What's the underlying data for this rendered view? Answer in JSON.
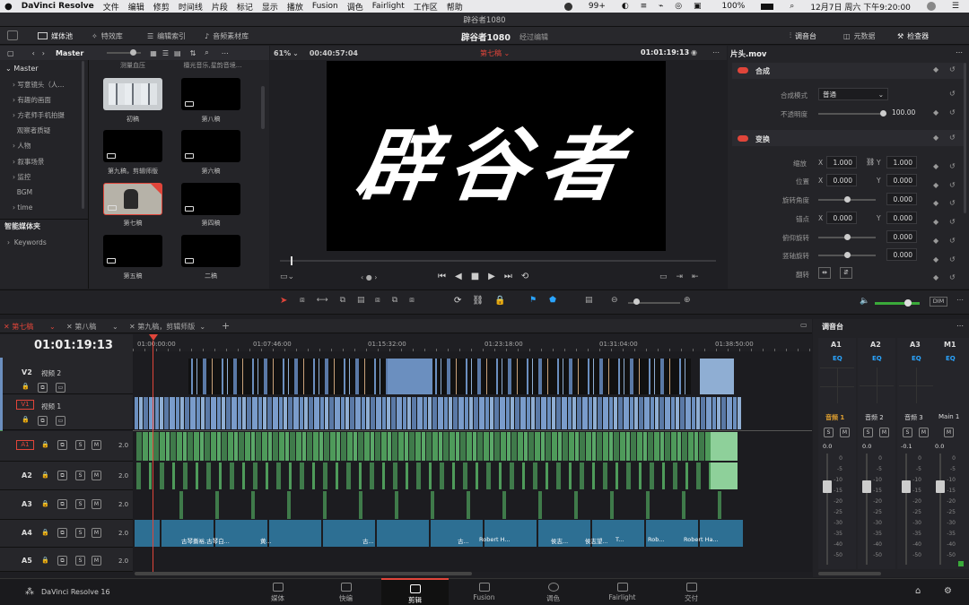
{
  "menubar": {
    "apple": "",
    "app": "DaVinci Resolve",
    "items": [
      "文件",
      "编辑",
      "修剪",
      "时间线",
      "片段",
      "标记",
      "显示",
      "播放",
      "Fusion",
      "调色",
      "Fairlight",
      "工作区",
      "帮助"
    ],
    "window_title": "辟谷者1080",
    "wechat_badge": "99+",
    "battery": "100%",
    "datetime": "12月7日 周六 下午9:20:00"
  },
  "toolbar": {
    "media_pool": "媒体池",
    "effects": "特效库",
    "edit_index": "编辑索引",
    "sound_library": "音频素材库",
    "project_title": "辟谷者1080",
    "project_status": "经过编辑",
    "mixer": "调音台",
    "metadata": "元数据",
    "inspector": "检查器"
  },
  "media_pool": {
    "bin_name": "Master",
    "tree_root": "Master",
    "bins": [
      "写意镜头（人...",
      "有趣的画面",
      "方老师手机拍摄",
      "观察者质疑",
      "人物",
      "叙事场景",
      "监控",
      "BGM",
      "time"
    ],
    "smart_bins_title": "智能媒体夹",
    "smart_bins": [
      "Keywords"
    ],
    "top_labels": [
      "测量血压",
      "檀光音乐,星韵音境..."
    ],
    "clips": [
      "初稿",
      "第八稿",
      "第九稿，剪辑师版",
      "第六稿",
      "第七稿",
      "第四稿",
      "第五稿",
      "二稿"
    ]
  },
  "viewer": {
    "zoom": "61%",
    "duration": "00:40:57:04",
    "timeline_name": "第七稿",
    "timecode": "01:01:19:13",
    "title_art": "辟谷者"
  },
  "inspector": {
    "clip_name": "片头.mov",
    "composite_section": "合成",
    "blend_mode_label": "合成模式",
    "blend_mode_value": "普通",
    "opacity_label": "不透明度",
    "opacity_value": "100.00",
    "transform_section": "变换",
    "zoom_label": "缩放",
    "zoom_x": "1.000",
    "zoom_y": "1.000",
    "position_label": "位置",
    "pos_x": "0.000",
    "pos_y": "0.000",
    "rotation_label": "旋转角度",
    "rotation_value": "0.000",
    "anchor_label": "锚点",
    "anchor_x": "0.000",
    "anchor_y": "0.000",
    "pitch_label": "俯仰旋转",
    "pitch_value": "0.000",
    "yaw_label": "竖轴旋转",
    "yaw_value": "0.000",
    "flip_label": "翻转",
    "x_axis": "X",
    "y_axis": "Y"
  },
  "timeline": {
    "tabs": [
      "第七稿",
      "第八稿",
      "第九稿，剪辑师版"
    ],
    "timecode": "01:01:19:13",
    "ruler": [
      "01:00:00:00",
      "01:07:46:00",
      "01:15:32:00",
      "01:23:18:00",
      "01:31:04:00",
      "01:38:50:00"
    ],
    "video_tracks": [
      {
        "id": "V2",
        "name": "视频 2"
      },
      {
        "id": "V1",
        "name": "视频 1"
      }
    ],
    "audio_tracks": [
      {
        "id": "A1",
        "level": "2.0"
      },
      {
        "id": "A2",
        "level": "2.0"
      },
      {
        "id": "A3",
        "level": "2.0"
      },
      {
        "id": "A4",
        "level": "2.0"
      },
      {
        "id": "A5",
        "level": "2.0"
      }
    ],
    "solo_label": "S",
    "mute_label": "M",
    "a4_clip_labels": [
      "古琴撕裕,古琴白...",
      "黄...",
      "古...",
      "古...",
      "Robert H...",
      "侯志...",
      "侯志望...",
      "T...",
      "Rob...",
      "Robert Ha..."
    ]
  },
  "mixer": {
    "title": "调音台",
    "channels": [
      "A1",
      "A2",
      "A3",
      "M1"
    ],
    "eq_label": "EQ",
    "strip_names": [
      "音频 1",
      "音频 2",
      "音频 3",
      "Main 1"
    ],
    "values": [
      "0.0",
      "0.0",
      "-0.1",
      "0.0"
    ],
    "scale": [
      "0",
      "-5",
      "-10",
      "-15",
      "-20",
      "-25",
      "-30",
      "-35",
      "-40",
      "-50"
    ],
    "dim_label": "DIM"
  },
  "pages": {
    "brand": "DaVinci Resolve 16",
    "items": [
      "媒体",
      "快编",
      "剪辑",
      "Fusion",
      "调色",
      "Fairlight",
      "交付"
    ],
    "active": "剪辑"
  },
  "colors": {
    "accent_red": "#e0453a",
    "video_clip": "#6b8fbf",
    "audio_clip": "#4e9a5a",
    "music_clip": "#2d6f93",
    "mixer_eq": "#2aa4ff"
  }
}
